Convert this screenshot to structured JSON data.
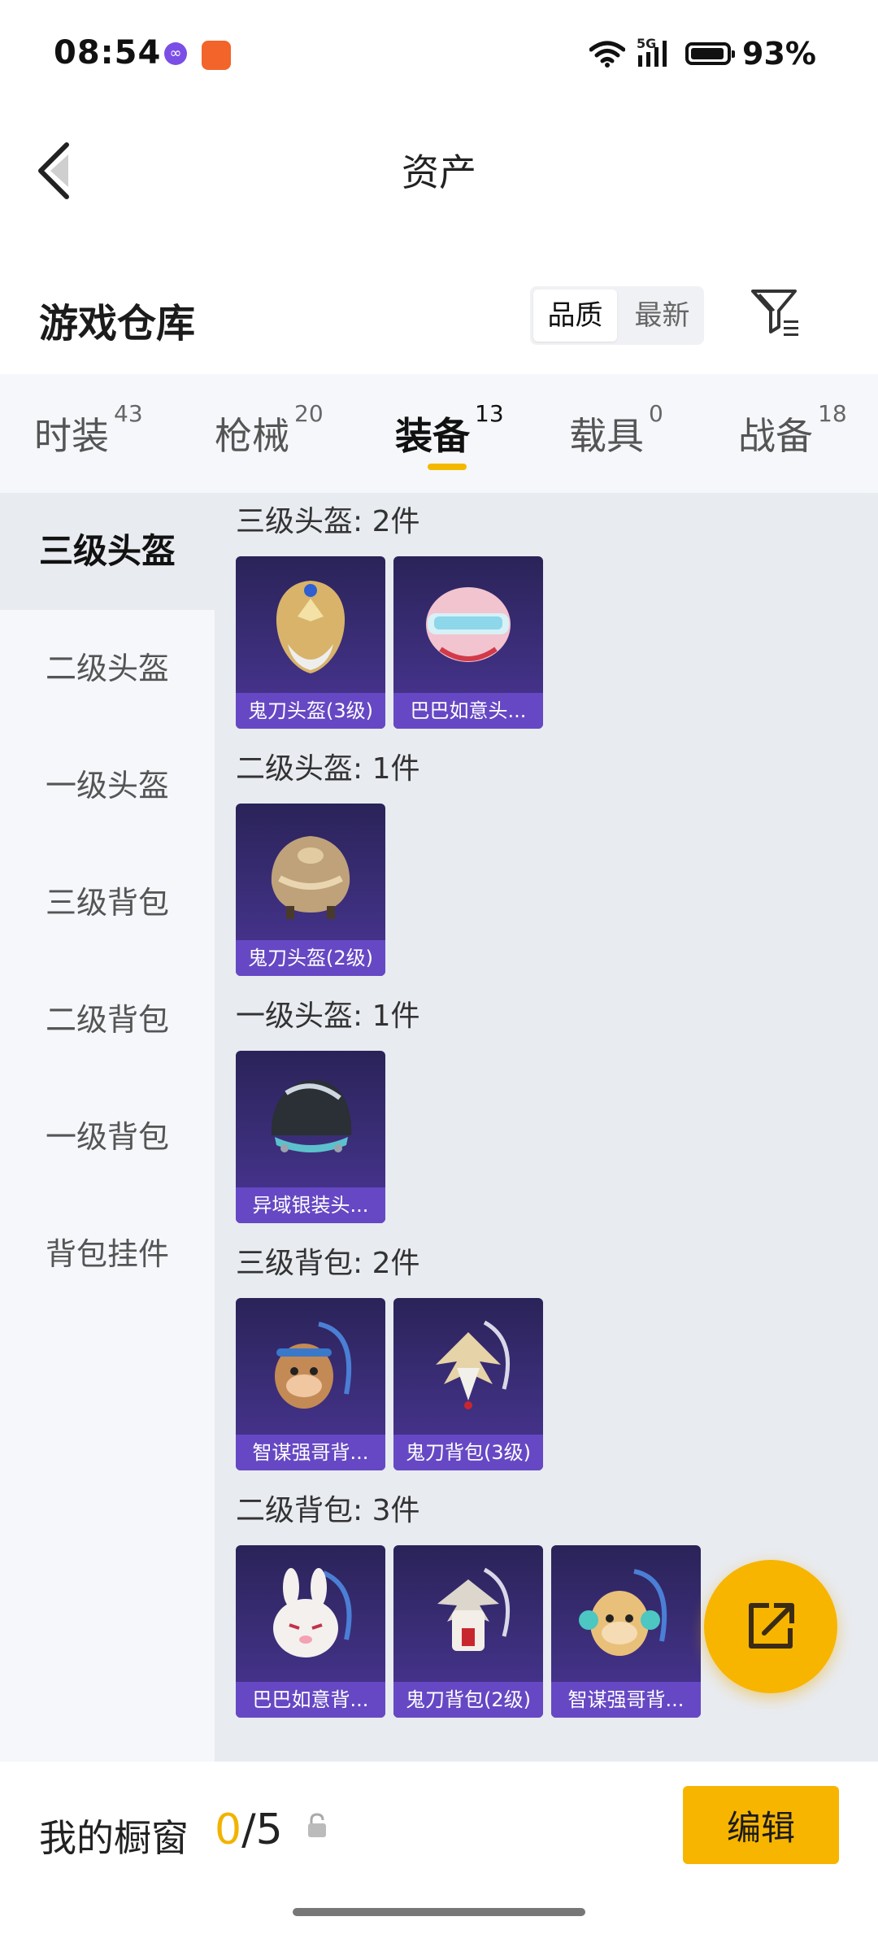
{
  "status_bar": {
    "time": "08:54",
    "network": "5G",
    "battery": "93%"
  },
  "header": {
    "title": "资产"
  },
  "warehouse": {
    "title": "游戏仓库",
    "sort_options": [
      "品质",
      "最新"
    ],
    "active_sort": "品质"
  },
  "tabs": [
    {
      "label": "时装",
      "count": "43"
    },
    {
      "label": "枪械",
      "count": "20"
    },
    {
      "label": "装备",
      "count": "13",
      "active": true
    },
    {
      "label": "载具",
      "count": "0"
    },
    {
      "label": "战备",
      "count": "18"
    }
  ],
  "side_nav": [
    {
      "label": "三级头盔",
      "active": true
    },
    {
      "label": "二级头盔"
    },
    {
      "label": "一级头盔"
    },
    {
      "label": "三级背包"
    },
    {
      "label": "二级背包"
    },
    {
      "label": "一级背包"
    },
    {
      "label": "背包挂件"
    }
  ],
  "sections": [
    {
      "title": "三级头盔: 2件",
      "items": [
        {
          "name": "鬼刀头盔(3级)",
          "icon": "golden-mask-helmet-icon"
        },
        {
          "name": "巴巴如意头...",
          "icon": "pink-helmet-icon"
        }
      ]
    },
    {
      "title": "二级头盔: 1件",
      "items": [
        {
          "name": "鬼刀头盔(2级)",
          "icon": "bronze-helmet-icon"
        }
      ]
    },
    {
      "title": "一级头盔: 1件",
      "items": [
        {
          "name": "异域银装头...",
          "icon": "black-helmet-icon"
        }
      ]
    },
    {
      "title": "三级背包: 2件",
      "items": [
        {
          "name": "智谋强哥背...",
          "icon": "plush-backpack-icon"
        },
        {
          "name": "鬼刀背包(3级)",
          "icon": "winged-backpack-icon"
        }
      ]
    },
    {
      "title": "二级背包: 3件",
      "items": [
        {
          "name": "巴巴如意背...",
          "icon": "bunny-backpack-icon"
        },
        {
          "name": "鬼刀背包(2级)",
          "icon": "winged-backpack-icon"
        },
        {
          "name": "智谋强哥背...",
          "icon": "plush-backpack-icon"
        }
      ]
    }
  ],
  "showcase": {
    "label": "我的橱窗",
    "current": "0",
    "separator": "/",
    "max": "5",
    "edit_label": "编辑"
  },
  "colors": {
    "accent": "#f7b500",
    "card_bg": "#3c2e7a",
    "card_label": "#6648c4"
  }
}
